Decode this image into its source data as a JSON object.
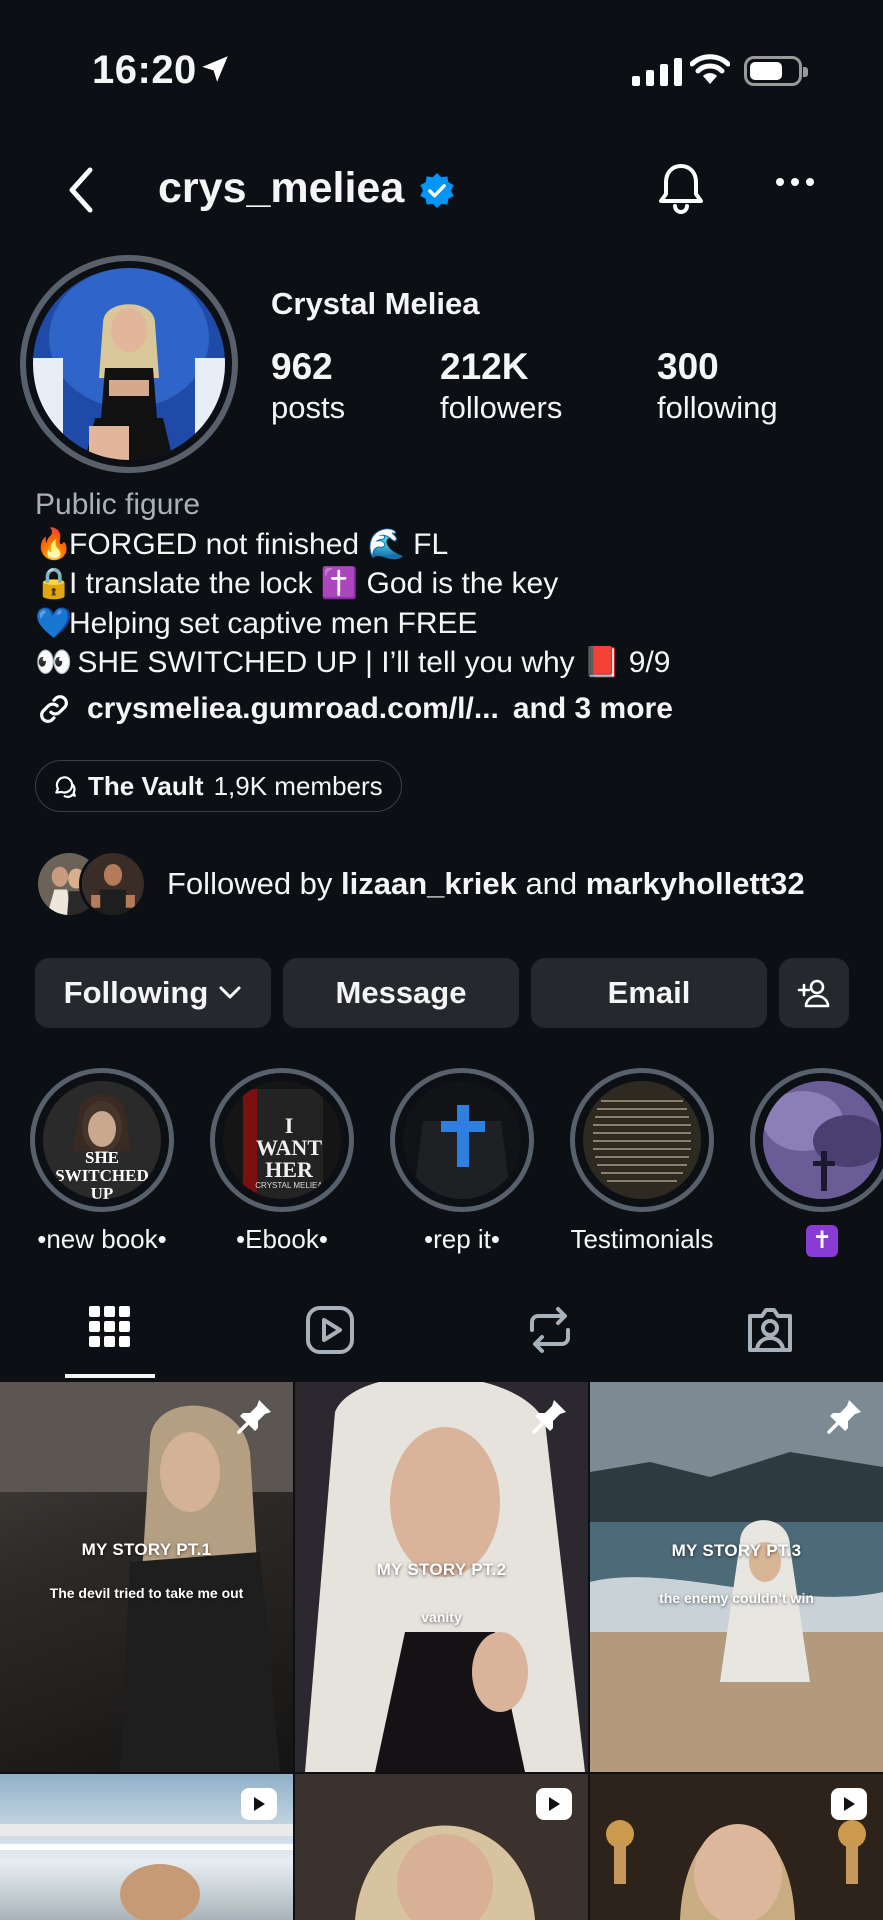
{
  "status_bar": {
    "time": "16:20"
  },
  "header": {
    "username": "crys_meliea"
  },
  "profile": {
    "full_name": "Crystal Meliea",
    "stats": [
      {
        "value": "962",
        "label": "posts"
      },
      {
        "value": "212K",
        "label": "followers"
      },
      {
        "value": "300",
        "label": "following"
      }
    ],
    "category": "Public figure",
    "bio": [
      {
        "emoji": "🔥",
        "text": "FORGED not finished 🌊 FL"
      },
      {
        "emoji": "🔒",
        "text": "I translate the lock ✝️ God is the key"
      },
      {
        "emoji": "💙",
        "text": "Helping set captive men FREE"
      },
      {
        "emoji": "👀",
        "text": " SHE SWITCHED UP | I’ll tell you why 📕 9/9"
      }
    ],
    "link": {
      "text": "crysmeliea.gumroad.com/l/...",
      "more": "and 3 more"
    },
    "channel": {
      "name": "The Vault",
      "members": "1,9K members"
    },
    "followed_by": {
      "prefix": "Followed by ",
      "user1": "lizaan_kriek",
      "and": " and ",
      "user2": "markyhollett32"
    }
  },
  "actions": {
    "following": "Following",
    "message": "Message",
    "email": "Email"
  },
  "highlights": [
    {
      "label": "•new book•",
      "cover_text": "SHE SWITCHED UP"
    },
    {
      "label": "•Ebook•",
      "cover_text": "I WANT HER",
      "cover_author": "CRYSTAL MELIEA"
    },
    {
      "label": "•rep it•"
    },
    {
      "label": "Testimonials"
    },
    {
      "label": "✝"
    }
  ],
  "posts": [
    {
      "title": "MY STORY PT.1",
      "subtitle": "The devil tried to take me out",
      "pinned": true
    },
    {
      "title": "MY STORY PT.2",
      "subtitle": "vanity",
      "pinned": true
    },
    {
      "title": "MY STORY PT.3",
      "subtitle": "the enemy couldn’t win",
      "pinned": true
    },
    {
      "reel": true
    },
    {
      "reel": true
    },
    {
      "reel": true
    }
  ],
  "colors": {
    "background": "#0c1014",
    "button": "#25292e",
    "verified": "#0095f6",
    "muted": "#a8b0ba"
  }
}
